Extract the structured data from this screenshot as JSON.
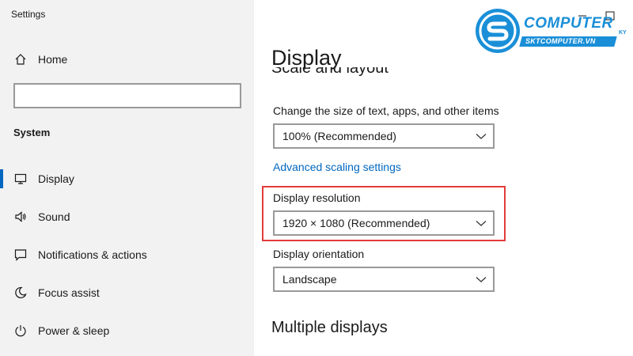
{
  "window": {
    "title": "Settings"
  },
  "sidebar": {
    "home_label": "Home",
    "search_placeholder": "",
    "section_label": "System",
    "items": [
      {
        "label": "Display",
        "icon": "monitor-icon",
        "active": true
      },
      {
        "label": "Sound",
        "icon": "speaker-icon"
      },
      {
        "label": "Notifications & actions",
        "icon": "notification-icon"
      },
      {
        "label": "Focus assist",
        "icon": "moon-icon"
      },
      {
        "label": "Power & sleep",
        "icon": "power-icon"
      }
    ]
  },
  "main": {
    "title": "Display",
    "section_heading": "Scale and layout",
    "scale": {
      "label": "Change the size of text, apps, and other items",
      "value": "100% (Recommended)"
    },
    "advanced_link": "Advanced scaling settings",
    "resolution": {
      "label": "Display resolution",
      "value": "1920 × 1080 (Recommended)"
    },
    "orientation": {
      "label": "Display orientation",
      "value": "Landscape"
    },
    "multiple_heading": "Multiple displays"
  },
  "logo": {
    "brand": "COMPUTER",
    "suffix": "KY",
    "url": "SKTCOMPUTER.VN"
  },
  "colors": {
    "accent": "#0067c0",
    "highlight": "#e33b3b",
    "logo": "#1a8fd8"
  }
}
